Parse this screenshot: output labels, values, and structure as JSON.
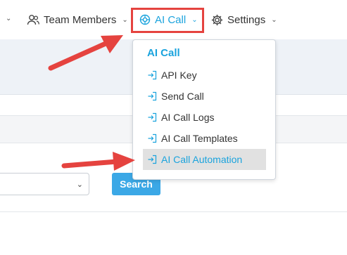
{
  "nav": {
    "items": [
      {
        "label": "Team Members",
        "icon": "users-icon"
      },
      {
        "label": "AI Call",
        "icon": "ai-icon",
        "active": true
      },
      {
        "label": "Settings",
        "icon": "gear-icon"
      }
    ]
  },
  "dropdown": {
    "header": "AI Call",
    "items": [
      {
        "label": "API Key",
        "icon": "login-arrow-icon"
      },
      {
        "label": "Send Call",
        "icon": "login-arrow-icon"
      },
      {
        "label": "AI Call Logs",
        "icon": "login-arrow-icon"
      },
      {
        "label": "AI Call Templates",
        "icon": "login-arrow-icon"
      },
      {
        "label": "AI Call Automation",
        "icon": "login-arrow-icon",
        "highlighted": true
      }
    ]
  },
  "filters": {
    "search_label": "Search"
  },
  "colors": {
    "accent": "#1aa3dd",
    "annotation": "#e5433f",
    "search_button": "#3ba8e6",
    "highlight_row": "#e1e1e1"
  }
}
